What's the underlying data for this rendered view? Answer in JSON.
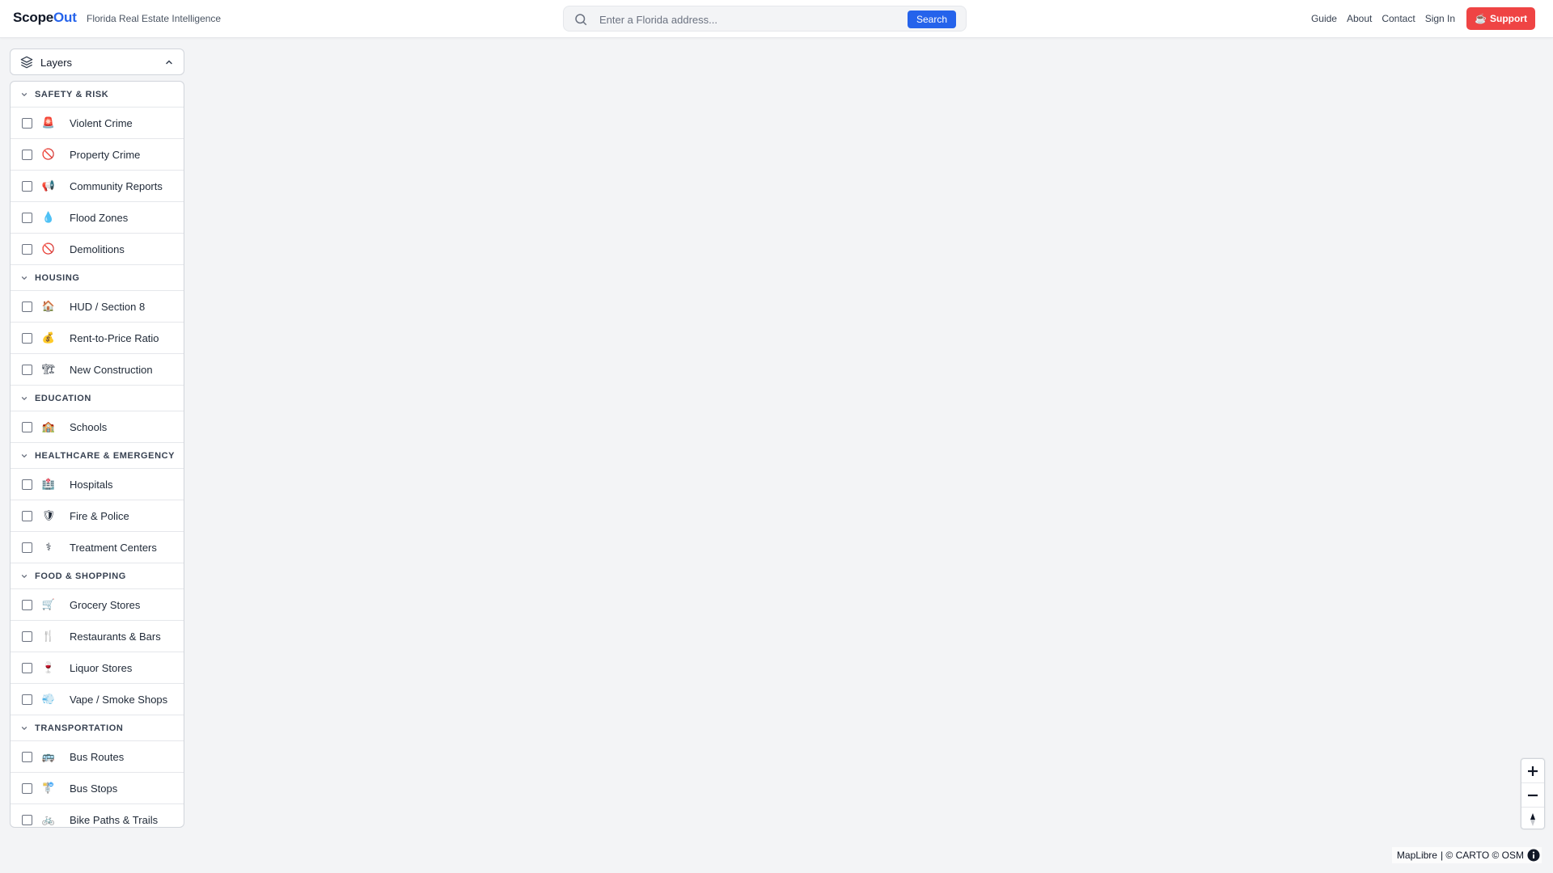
{
  "header": {
    "brand_part1": "Scope",
    "brand_part2": "Out",
    "tagline": "Florida Real Estate Intelligence",
    "search_placeholder": "Enter a Florida address...",
    "search_button": "Search",
    "nav": [
      "Guide",
      "About",
      "Contact",
      "Sign In"
    ],
    "support_icon": "☕",
    "support_label": "Support",
    "accent_color": "#2563eb",
    "support_color": "#ef4444"
  },
  "layers": {
    "title": "Layers",
    "categories": [
      {
        "name": "SAFETY & RISK",
        "items": [
          {
            "label": "Violent Crime",
            "icon": "🚨"
          },
          {
            "label": "Property Crime",
            "icon": "🚫"
          },
          {
            "label": "Community Reports",
            "icon": "📢"
          },
          {
            "label": "Flood Zones",
            "icon": "💧"
          },
          {
            "label": "Demolitions",
            "icon": "🚫"
          }
        ]
      },
      {
        "name": "HOUSING",
        "items": [
          {
            "label": "HUD / Section 8",
            "icon": "🏠"
          },
          {
            "label": "Rent-to-Price Ratio",
            "icon": "💰"
          },
          {
            "label": "New Construction",
            "icon": "🏗"
          }
        ]
      },
      {
        "name": "EDUCATION",
        "items": [
          {
            "label": "Schools",
            "icon": "🏫"
          }
        ]
      },
      {
        "name": "HEALTHCARE & EMERGENCY",
        "items": [
          {
            "label": "Hospitals",
            "icon": "🏥"
          },
          {
            "label": "Fire & Police",
            "icon": "🛡"
          },
          {
            "label": "Treatment Centers",
            "icon": "⚕"
          }
        ]
      },
      {
        "name": "FOOD & SHOPPING",
        "items": [
          {
            "label": "Grocery Stores",
            "icon": "🛒"
          },
          {
            "label": "Restaurants & Bars",
            "icon": "🍴"
          },
          {
            "label": "Liquor Stores",
            "icon": "🍷"
          },
          {
            "label": "Vape / Smoke Shops",
            "icon": "💨"
          }
        ]
      },
      {
        "name": "TRANSPORTATION",
        "items": [
          {
            "label": "Bus Routes",
            "icon": "🚌"
          },
          {
            "label": "Bus Stops",
            "icon": "🚏"
          },
          {
            "label": "Bike Paths & Trails",
            "icon": "🚲"
          }
        ]
      }
    ]
  },
  "map": {
    "attribution_lib": "MapLibre",
    "attribution_rest": "| © CARTO © OSM"
  }
}
